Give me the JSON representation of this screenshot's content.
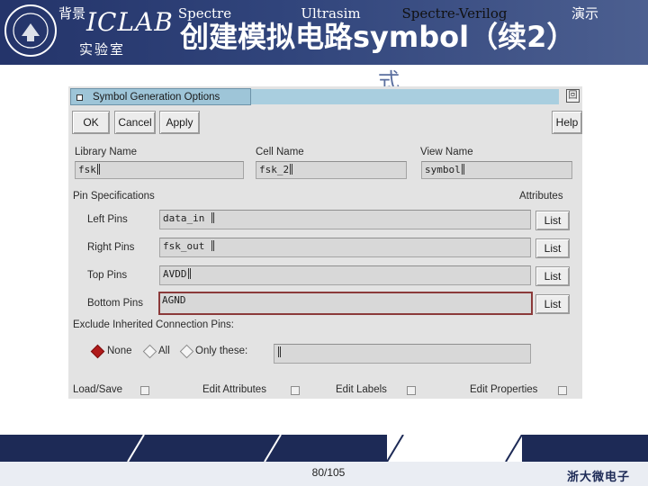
{
  "slide": {
    "logo_brand": "ICLAB",
    "logo_sub": "实验室",
    "title": "创建模拟电路symbol（续2）",
    "title_overflow": "式"
  },
  "dialog": {
    "title": "Symbol Generation Options",
    "window_menu_glyph": "回",
    "buttons": {
      "ok": "OK",
      "cancel": "Cancel",
      "apply": "Apply",
      "help": "Help"
    },
    "library": {
      "label": "Library Name",
      "value": "fsk"
    },
    "cell": {
      "label": "Cell Name",
      "value": "fsk_2"
    },
    "view": {
      "label": "View Name",
      "value": "symbol"
    },
    "pin_spec_label": "Pin Specifications",
    "attributes_label": "Attributes",
    "pins": [
      {
        "label": "Left Pins",
        "value": "data_in",
        "button": "List"
      },
      {
        "label": "Right Pins",
        "value": "fsk_out",
        "button": "List"
      },
      {
        "label": "Top Pins",
        "value": "AVDD",
        "button": "List"
      },
      {
        "label": "Bottom Pins",
        "value": "AGND",
        "button": "List"
      }
    ],
    "exclude_label": "Exclude Inherited Connection Pins:",
    "exclude_options": {
      "none": "None",
      "all": "All",
      "only": "Only these:"
    },
    "exclude_selected": "None",
    "only_these_value": "",
    "bottom_checks": {
      "load_save": "Load/Save",
      "edit_attributes": "Edit Attributes",
      "edit_labels": "Edit Labels",
      "edit_properties": "Edit Properties"
    }
  },
  "nav": {
    "items": [
      "背景",
      "Spectre",
      "Ultrasim",
      "Spectre-Verilog",
      "演示"
    ],
    "active": "Spectre-Verilog"
  },
  "footer": {
    "page": "80/105",
    "brand": "浙大微电子"
  },
  "colors": {
    "header_navy": "#24346a",
    "titlebar_blue": "#9ec5d8",
    "dialog_gray": "#e3e3e3",
    "selected_radio": "#b01a1a"
  }
}
